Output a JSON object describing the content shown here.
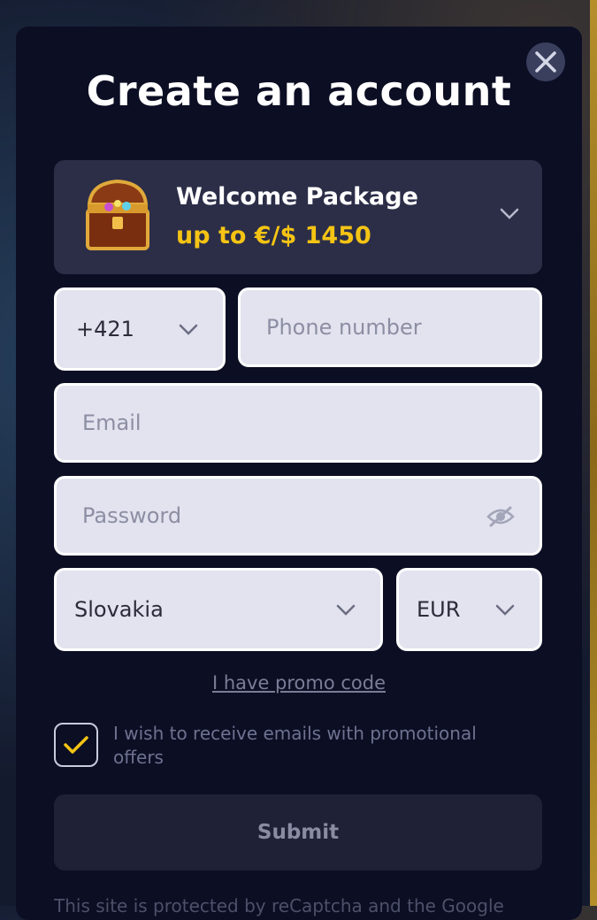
{
  "modal": {
    "title": "Create an account",
    "close_icon": "close-icon"
  },
  "welcome": {
    "title": "Welcome Package",
    "amount": "up to €/$ 1450",
    "icon": "treasure-chest-icon"
  },
  "form": {
    "phone_code": "+421",
    "phone_placeholder": "Phone number",
    "email_placeholder": "Email",
    "password_placeholder": "Password",
    "country": "Slovakia",
    "currency": "EUR",
    "promo_link": "I have promo code",
    "checkbox_label": "I wish to receive emails with promotional offers",
    "checkbox_checked": true,
    "submit_label": "Submit"
  },
  "footer": {
    "text": "This site is protected by reCaptcha and the Google"
  },
  "colors": {
    "background": "#0c0e24",
    "accent": "#f5c414",
    "field": "#e2e3ef",
    "welcome_bg": "#2c2e48"
  }
}
